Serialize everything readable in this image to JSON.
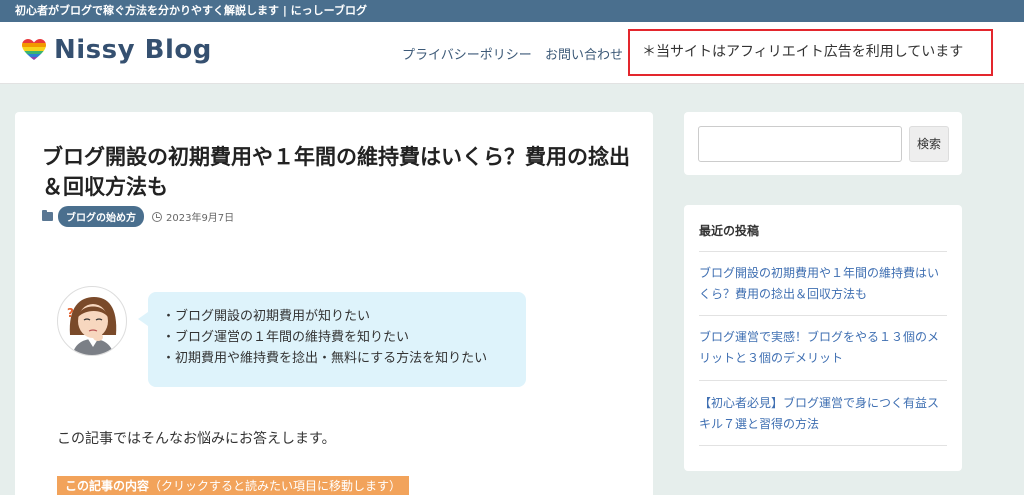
{
  "top_bar": {
    "tagline": "初心者がブログで稼ぐ方法を分かりやすく解説します | にっしーブログ"
  },
  "header": {
    "logo_text": "Nissy Blog",
    "nav": [
      {
        "label": "プライバシーポリシー"
      },
      {
        "label": "お問い合わせ"
      }
    ],
    "notice": "＊当サイトはアフィリエイト広告を利用しています"
  },
  "article": {
    "title": "ブログ開設の初期費用や１年間の維持費はいくら？費用の捻出＆回収方法も",
    "category": "ブログの始め方",
    "date": "2023年9月7日",
    "bubble_lines": [
      "・ブログ開設の初期費用が知りたい",
      "・ブログ運営の１年間の維持費を知りたい",
      "・初期費用や維持費を捻出・無料にする方法を知りたい"
    ],
    "intro": "この記事ではそんなお悩みにお答えします。",
    "toc_label": "この記事の内容",
    "toc_hint": "（クリックすると読みたい項目に移動します）"
  },
  "sidebar": {
    "search_button": "検索",
    "recent_title": "最近の投稿",
    "recent_posts": [
      {
        "title": "ブログ開設の初期費用や１年間の維持費はいくら？費用の捻出＆回収方法も"
      },
      {
        "title": "ブログ運営で実感！ブログをやる１３個のメリットと３個のデメリット"
      },
      {
        "title": "【初心者必見】ブログ運営で身につく有益スキル７選と習得の方法"
      }
    ]
  },
  "colors": {
    "brand": "#4a6f8e",
    "notice_border": "#e3262d",
    "link": "#3f6fb2",
    "bubble": "#def3fb",
    "toc": "#f2a35b"
  }
}
